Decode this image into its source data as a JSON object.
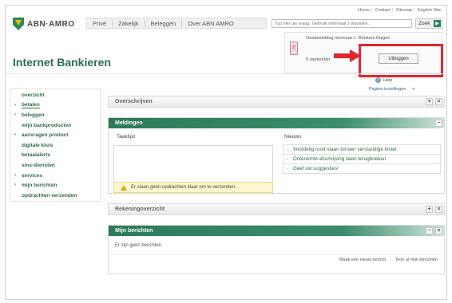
{
  "top_links": [
    "Home",
    "Contact",
    "Sitemap",
    "English Site"
  ],
  "brand": {
    "name": "ABN·AMRO",
    "colors": {
      "green": "#2b8a57",
      "yellow": "#f2c200"
    }
  },
  "nav": {
    "items": [
      "Privé",
      "Zakelijk",
      "Beleggen",
      "Over ABN AMRO"
    ]
  },
  "search": {
    "placeholder": "Typ hier uw vraag. Gebruik minimaal 2 woorden.",
    "button_label": "Zoek",
    "button_icon": "arrow-right-icon"
  },
  "page_title": "Internet Bankieren",
  "greeting": {
    "text": "Goedemiddag mevrouw L. Brinkers-Huigen",
    "date": "5 september",
    "icon": "phone-icon"
  },
  "logout_label": "Uitloggen",
  "help_label": "Help",
  "settings_label": "Pagina-instellingen",
  "sidebar": {
    "items": [
      {
        "label": "overzicht",
        "bullet": false,
        "active": false
      },
      {
        "label": "betalen",
        "bullet": true,
        "active": true
      },
      {
        "label": "beleggen",
        "bullet": true,
        "active": false
      },
      {
        "label": "mijn bankproducten",
        "bullet": false,
        "active": false
      },
      {
        "label": "aanvragen product",
        "bullet": true,
        "active": false
      },
      {
        "label": "digitale kluis",
        "bullet": false,
        "active": false
      },
      {
        "label": "betaalalerts",
        "bullet": false,
        "active": false
      },
      {
        "label": "sms-diensten",
        "bullet": false,
        "active": false
      },
      {
        "label": "services",
        "bullet": true,
        "active": false
      },
      {
        "label": "mijn berichten",
        "bullet": true,
        "active": false
      },
      {
        "label": "opdrachten verzenden",
        "bullet": false,
        "active": false
      }
    ]
  },
  "widgets": {
    "overschrijven": {
      "title": "Overschrijven"
    },
    "meldingen": {
      "title": "Meldingen",
      "taaklijst_title": "Taaklijst",
      "warning_text": "Er staan geen opdrachten klaar om te verzenden.",
      "nieuws_title": "Nieuws",
      "news": [
        "Voordelig rood staan tot een verstandige limiet",
        "Onterechte afschrijving laten terugboeken",
        "Geef uw suggesties!"
      ]
    },
    "rekeningoverzicht": {
      "title": "Rekeningoverzicht"
    },
    "berichten": {
      "title": "Mijn berichten",
      "empty_text": "Er zijn geen berichten.",
      "new_message_label": "Maak een nieuw bericht",
      "all_messages_label": "Toon al mijn berichten"
    }
  },
  "highlight_color": "#e3262d"
}
